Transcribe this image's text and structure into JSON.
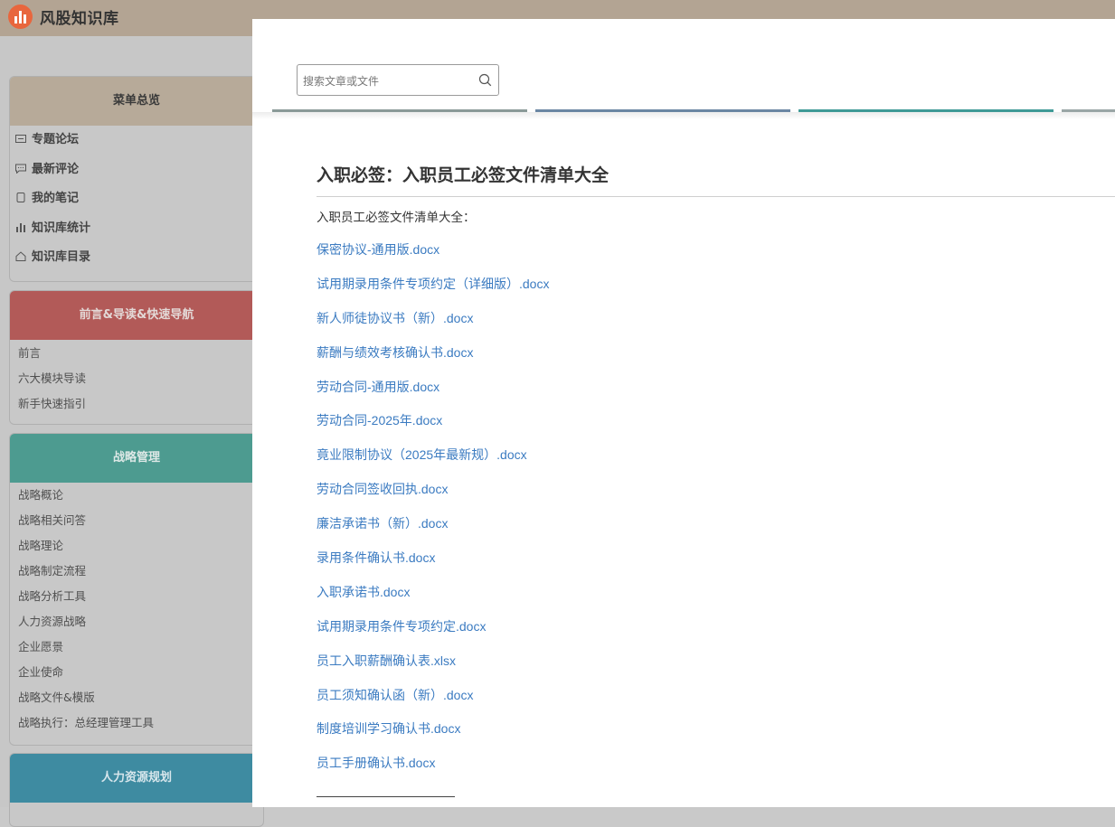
{
  "brand": {
    "name": "风股知识库",
    "logo_icon": "bar-chart-logo-icon",
    "logo_color": "#e8663d"
  },
  "sidebar": {
    "overview": {
      "title": "菜单总览",
      "color": "#b7aa99",
      "items": [
        {
          "label": "专题论坛",
          "icon": "forum-icon"
        },
        {
          "label": "最新评论",
          "icon": "comment-icon"
        },
        {
          "label": "我的笔记",
          "icon": "note-icon"
        },
        {
          "label": "知识库统计",
          "icon": "stats-icon"
        },
        {
          "label": "知识库目录",
          "icon": "home-icon"
        }
      ]
    },
    "intro": {
      "title": "前言&导读&快速导航",
      "color": "#b25a58",
      "items": [
        "前言",
        "六大模块导读",
        "新手快速指引"
      ]
    },
    "strategy": {
      "title": "战略管理",
      "color": "#4d9b90",
      "items": [
        "战略概论",
        "战略相关问答",
        "战略理论",
        "战略制定流程",
        "战略分析工具",
        "人力资源战略",
        "企业愿景",
        "企业使命",
        "战略文件&模版",
        "战略执行：总经理管理工具"
      ]
    },
    "hr_planning": {
      "title": "人力资源规划",
      "color": "#3e8ba1"
    }
  },
  "search": {
    "placeholder": "搜索文章或文件",
    "value": ""
  },
  "article": {
    "title": "入职必签：入职员工必签文件清单大全",
    "intro": "入职员工必签文件清单大全：",
    "files": [
      "保密协议-通用版.docx",
      "试用期录用条件专项约定（详细版）.docx",
      "新人师徒协议书（新）.docx",
      "薪酬与绩效考核确认书.docx",
      "劳动合同-通用版.docx",
      "劳动合同-2025年.docx",
      "竟业限制协议（2025年最新规）.docx",
      "劳动合同签收回执.docx",
      "廉洁承诺书（新）.docx",
      "录用条件确认书.docx",
      "入职承诺书.docx",
      "试用期录用条件专项约定.docx",
      "员工入职薪酬确认表.xlsx",
      "员工须知确认函（新）.docx",
      "制度培训学习确认书.docx",
      "员工手册确认书.docx"
    ]
  },
  "colors": {
    "link": "#3b7bc1",
    "topbar": "#b3a493"
  }
}
